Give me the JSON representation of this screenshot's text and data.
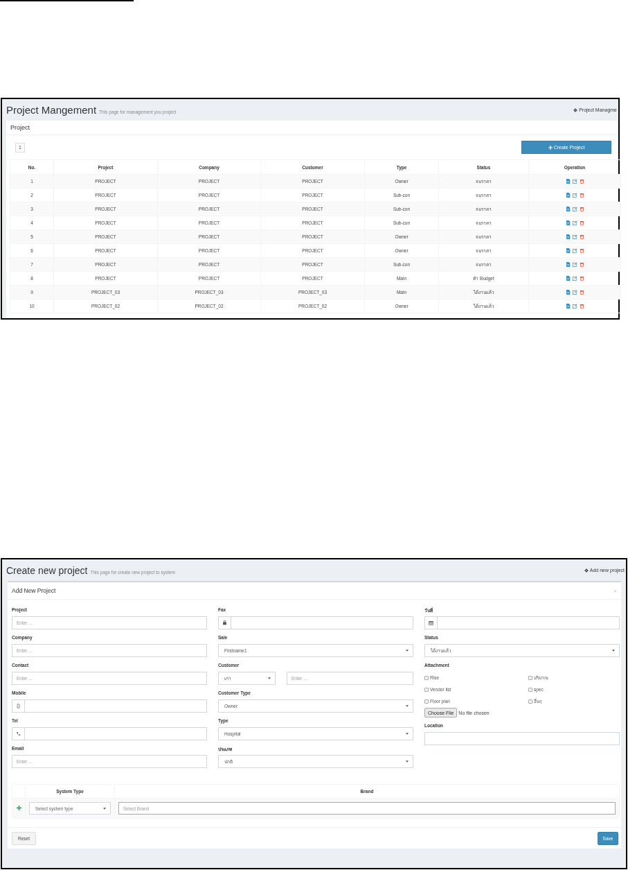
{
  "project_list": {
    "title": "Project Mangement",
    "subtitle": "This page for management you project",
    "breadcrumb": "Project Managme",
    "box_title": "Project",
    "page": "1",
    "create_button": "Create Project",
    "table": {
      "columns": [
        "No.",
        "Project",
        "Company",
        "Customer",
        "Type",
        "Status",
        "Operation"
      ],
      "rows": [
        {
          "no": "1",
          "project": "PROJECT",
          "company": "PROJECT",
          "customer": "PROJECT",
          "type": "Owner",
          "status": "จบราคา"
        },
        {
          "no": "2",
          "project": "PROJECT",
          "company": "PROJECT",
          "customer": "PROJECT",
          "type": "Sub-con",
          "status": "จบราคา"
        },
        {
          "no": "3",
          "project": "PROJECT",
          "company": "PROJECT",
          "customer": "PROJECT",
          "type": "Sub-con",
          "status": "จบราคา"
        },
        {
          "no": "4",
          "project": "PROJECT",
          "company": "PROJECT",
          "customer": "PROJECT",
          "type": "Sub-con",
          "status": "จบราคา"
        },
        {
          "no": "5",
          "project": "PROJECT",
          "company": "PROJECT",
          "customer": "PROJECT",
          "type": "Owner",
          "status": "จบราคา"
        },
        {
          "no": "6",
          "project": "PROJECT",
          "company": "PROJECT",
          "customer": "PROJECT",
          "type": "Owner",
          "status": "จบราคา"
        },
        {
          "no": "7",
          "project": "PROJECT",
          "company": "PROJECT",
          "customer": "PROJECT",
          "type": "Sub-con",
          "status": "จบราคา"
        },
        {
          "no": "8",
          "project": "PROJECT",
          "company": "PROJECT",
          "customer": "PROJECT",
          "type": "Main",
          "status": "ทำ Budget"
        },
        {
          "no": "9",
          "project": "PROJECT_03",
          "company": "PROJECT_03",
          "customer": "PROJECT_03",
          "type": "Main",
          "status": "ได้งานแล้ว"
        },
        {
          "no": "10",
          "project": "PROJECT_02",
          "company": "PROJECT_02",
          "customer": "PROJECT_02",
          "type": "Owner",
          "status": "ได้งานแล้ว"
        }
      ]
    }
  },
  "create_form": {
    "title": "Create new project",
    "subtitle": "This page for create new project to system",
    "breadcrumb": "Add new project",
    "box_title": "Add New Project",
    "close": "×",
    "columns": [
      [
        {
          "kind": "text",
          "label": "Project",
          "placeholder": "Enter ..."
        },
        {
          "kind": "text",
          "label": "Company",
          "placeholder": "Enter ..."
        },
        {
          "kind": "text",
          "label": "Contact",
          "placeholder": "Enter ..."
        },
        {
          "kind": "mobile",
          "label": "Mobile"
        },
        {
          "kind": "phone",
          "label": "Tel"
        },
        {
          "kind": "text",
          "label": "Email",
          "placeholder": "Enter ..."
        }
      ],
      [
        {
          "kind": "fax",
          "label": "Fax"
        },
        {
          "kind": "select",
          "label": "Sale",
          "value": "Firstname1"
        },
        {
          "kind": "select_text",
          "label": "Customer",
          "value": "เก่า",
          "placeholder": "Enter ..."
        },
        {
          "kind": "select",
          "label": "Customer Type",
          "value": "Owner"
        },
        {
          "kind": "select",
          "label": "Type",
          "value": "Hospital"
        },
        {
          "kind": "select",
          "label": "ประเภท",
          "value": "ปกติ"
        }
      ],
      [
        {
          "kind": "date",
          "label": "วันที่"
        },
        {
          "kind": "select",
          "label": "Status",
          "value": "ได้งานแล้ว"
        },
        {
          "kind": "attachment",
          "label": "Attachment",
          "options": [
            {
              "label": "Rise",
              "checked": false
            },
            {
              "label": "ปริมาณ",
              "checked": false
            },
            {
              "label": "Vendor list",
              "checked": false
            },
            {
              "label": "spec",
              "checked": false
            },
            {
              "label": "Floor plan",
              "checked": false
            },
            {
              "label": "อื่นๆ",
              "checked": false
            }
          ],
          "file_button": "Choose File",
          "file_status": "No file chosen"
        },
        {
          "kind": "text",
          "label": "Location"
        }
      ]
    ],
    "system_table": {
      "columns": [
        "System Type",
        "Brand"
      ],
      "system_type": "Select system type",
      "brand_placeholder": "Select Brand"
    },
    "reset_button": "Reset",
    "save_button": "Save"
  }
}
